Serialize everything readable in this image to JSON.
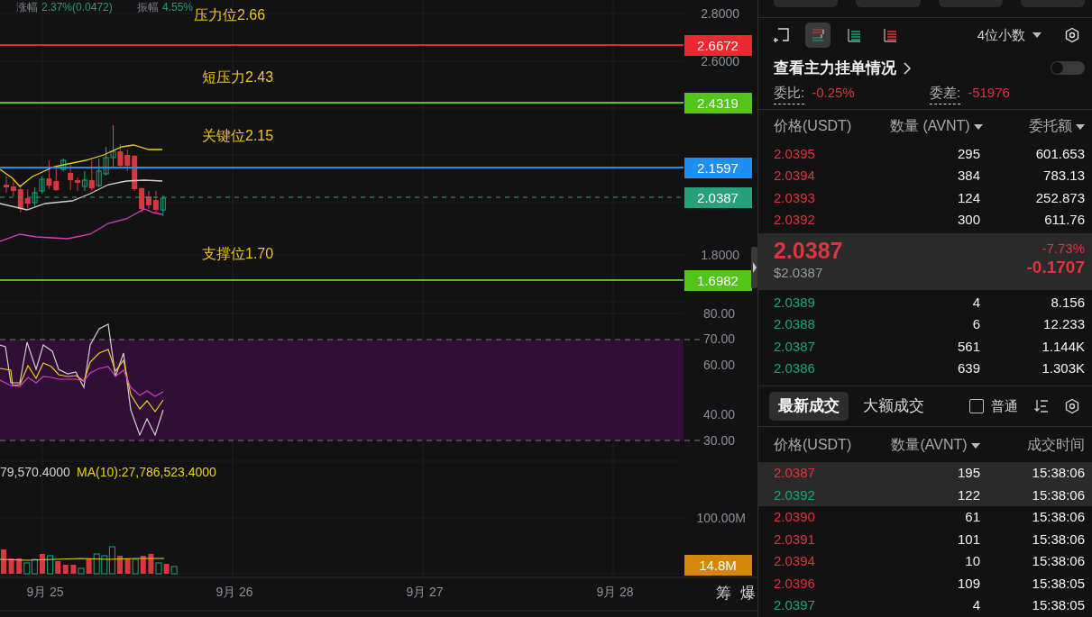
{
  "chart": {
    "stats": [
      {
        "label": "涨幅",
        "value": "2.37%(0.0472)"
      },
      {
        "label": "振幅",
        "value": "4.55%"
      }
    ],
    "price_axis": [
      "2.8000",
      "2.6000",
      "1.8000"
    ],
    "levels": [
      {
        "label": "压力位2.66",
        "tag": "2.6672",
        "color": "#f0262f",
        "kind": "level"
      },
      {
        "label": "短压力2.43",
        "tag": "2.4319",
        "color": "#52c41a",
        "kind": "level"
      },
      {
        "label": "关键位2.15",
        "tag": "2.1597",
        "color": "#1e8ff0",
        "kind": "level"
      },
      {
        "tag": "2.0387",
        "color": "#26a17b",
        "kind": "current"
      },
      {
        "label": "支撑位1.70",
        "tag": "1.6982",
        "color": "#52c41a",
        "kind": "level"
      }
    ],
    "rsi_axis": [
      "80.00",
      "70.00",
      "60.00",
      "40.00",
      "30.00"
    ],
    "volume_readouts": [
      {
        "text": "79,570.4000",
        "kind": "plain"
      },
      {
        "text": "MA(10):27,786,523.4000",
        "kind": "ma10"
      }
    ],
    "volume_axis": "100.00M",
    "volume_tag": "14.8M",
    "dates": [
      "9月 25",
      "9月 26",
      "9月 27",
      "9月 28"
    ],
    "side_buttons": [
      "筹",
      "爆"
    ]
  },
  "order_book": {
    "view_modes": [
      {
        "kind": "both",
        "selected": true
      },
      {
        "kind": "bids",
        "selected": false
      },
      {
        "kind": "asks",
        "selected": false
      }
    ],
    "precision": "4位小数",
    "main_orders": {
      "label": "查看主力挂单情况",
      "on": false
    },
    "ratio": {
      "label": "委比:",
      "value": "-0.25%"
    },
    "diff": {
      "label": "委差:",
      "value": "-51976"
    },
    "columns": [
      {
        "label": "价格(USDT)",
        "dropdown": false
      },
      {
        "label": "数量 (AVNT)",
        "dropdown": true
      },
      {
        "label": "委托额",
        "dropdown": true
      }
    ],
    "asks": [
      {
        "price": "2.0395",
        "qty": "295",
        "amount": "601.653"
      },
      {
        "price": "2.0394",
        "qty": "384",
        "amount": "783.13"
      },
      {
        "price": "2.0393",
        "qty": "124",
        "amount": "252.873"
      },
      {
        "price": "2.0392",
        "qty": "300",
        "amount": "611.76"
      }
    ],
    "last": {
      "price": "2.0387",
      "usd": "$2.0387",
      "change_pct": "-7.73%",
      "change": "-0.1707"
    },
    "bids": [
      {
        "price": "2.0389",
        "qty": "4",
        "amount": "8.156"
      },
      {
        "price": "2.0388",
        "qty": "6",
        "amount": "12.233"
      },
      {
        "price": "2.0387",
        "qty": "561",
        "amount": "1.144K"
      },
      {
        "price": "2.0386",
        "qty": "639",
        "amount": "1.303K"
      }
    ]
  },
  "trades": {
    "tabs": [
      {
        "label": "最新成交",
        "selected": true
      },
      {
        "label": "大额成交",
        "selected": false
      }
    ],
    "filter": {
      "label": "普通",
      "checked": false
    },
    "columns": [
      {
        "label": "价格(USDT)",
        "dropdown": false
      },
      {
        "label": "数量(AVNT)",
        "dropdown": true
      },
      {
        "label": "成交时间",
        "dropdown": false
      }
    ],
    "rows": [
      {
        "price": "2.0387",
        "qty": "195",
        "time": "15:38:06",
        "color": "#d9363e",
        "highlighted": true
      },
      {
        "price": "2.0392",
        "qty": "122",
        "time": "15:38:06",
        "color": "#1fa37a",
        "highlighted": true
      },
      {
        "price": "2.0390",
        "qty": "61",
        "time": "15:38:06",
        "color": "#d9363e",
        "highlighted": false
      },
      {
        "price": "2.0391",
        "qty": "101",
        "time": "15:38:06",
        "color": "#d9363e",
        "highlighted": false
      },
      {
        "price": "2.0394",
        "qty": "10",
        "time": "15:38:06",
        "color": "#d9363e",
        "highlighted": false
      },
      {
        "price": "2.0396",
        "qty": "109",
        "time": "15:38:05",
        "color": "#d9363e",
        "highlighted": false
      },
      {
        "price": "2.0397",
        "qty": "4",
        "time": "15:38:05",
        "color": "#1fa37a",
        "highlighted": false
      }
    ]
  }
}
